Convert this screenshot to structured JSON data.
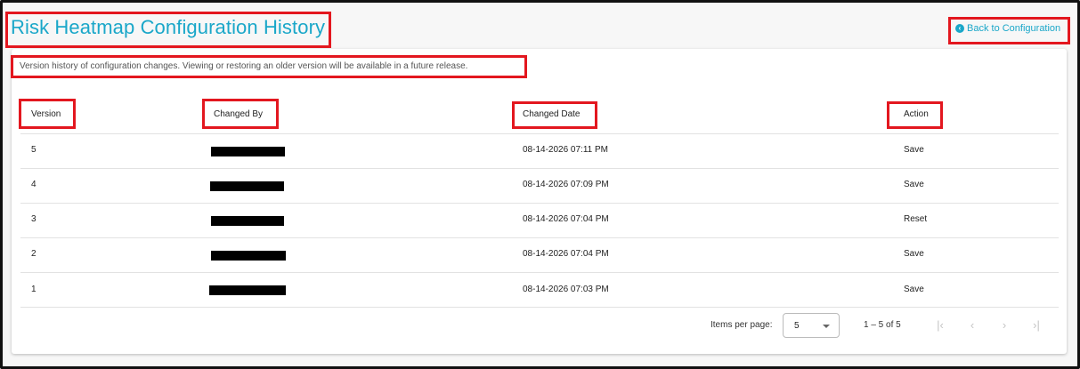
{
  "header": {
    "title": "Risk Heatmap Configuration History",
    "back_icon": "chevron-circle-left-icon",
    "back_label": "Back to Configuration"
  },
  "description": "Version history of configuration changes. Viewing or restoring an older version will be available in a future release.",
  "table": {
    "columns": [
      "Version",
      "Changed By",
      "Changed Date",
      "Action"
    ],
    "rows": [
      {
        "version": "5",
        "changed_by": "[redacted]",
        "date": "08-14-2026 07:11 PM",
        "action": "Save"
      },
      {
        "version": "4",
        "changed_by": "[redacted]",
        "date": "08-14-2026 07:09 PM",
        "action": "Save"
      },
      {
        "version": "3",
        "changed_by": "[redacted]",
        "date": "08-14-2026 07:04 PM",
        "action": "Reset"
      },
      {
        "version": "2",
        "changed_by": "[redacted]",
        "date": "08-14-2026 07:04 PM",
        "action": "Save"
      },
      {
        "version": "1",
        "changed_by": "[redacted]",
        "date": "08-14-2026 07:03 PM",
        "action": "Save"
      }
    ]
  },
  "paginator": {
    "items_per_page_label": "Items per page:",
    "page_size": "5",
    "range_label": "1 – 5 of 5",
    "first_icon": "first-page-icon",
    "prev_icon": "chevron-left-icon",
    "next_icon": "chevron-right-icon",
    "last_icon": "last-page-icon"
  },
  "colors": {
    "accent": "#1aa7c9",
    "highlight": "#e3171f"
  }
}
